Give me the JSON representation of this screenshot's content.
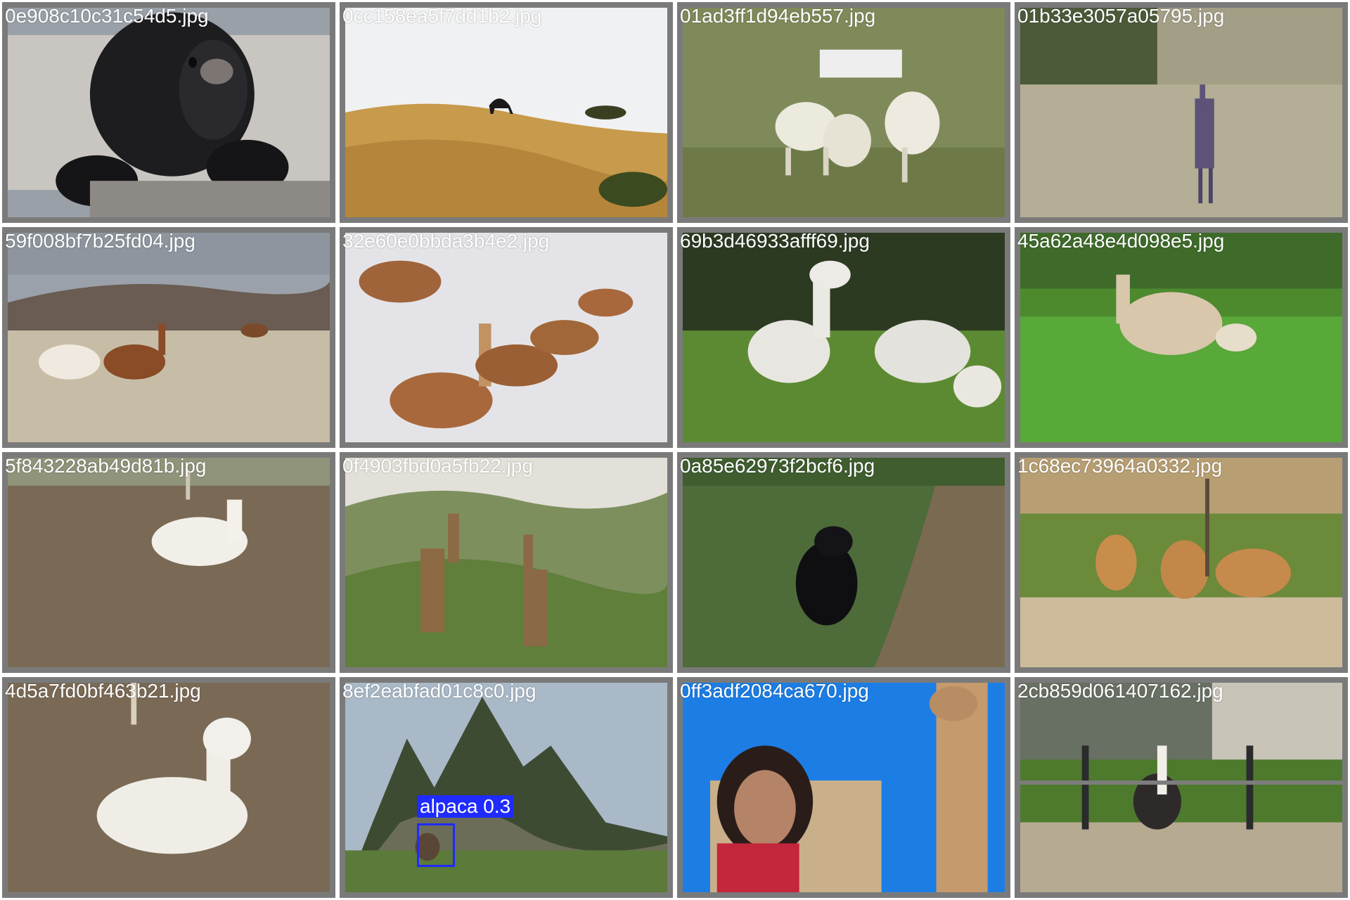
{
  "grid": {
    "cells": [
      {
        "filename": "0e908c10c31c54d5.jpg",
        "scene": "bear-closeup"
      },
      {
        "filename": "0cc158ea5f7dd1b2.jpg",
        "scene": "camel-dune"
      },
      {
        "filename": "01ad3ff1d94eb557.jpg",
        "scene": "lambs-sign"
      },
      {
        "filename": "01b33e3057a05795.jpg",
        "scene": "giraffe-grass"
      },
      {
        "filename": "59f008bf7b25fd04.jpg",
        "scene": "llamas-steppe"
      },
      {
        "filename": "32e60e0bbda3b4e2.jpg",
        "scene": "guanacos-snow"
      },
      {
        "filename": "69b3d46933afff69.jpg",
        "scene": "alpacas-white"
      },
      {
        "filename": "45a62a48e4d098e5.jpg",
        "scene": "alpaca-grazing"
      },
      {
        "filename": "5f843228ab49d81b.jpg",
        "scene": "alpaca-resting"
      },
      {
        "filename": "0f4903fbd0a5fb22.jpg",
        "scene": "giraffes-hills"
      },
      {
        "filename": "0a85e62973f2bcf6.jpg",
        "scene": "bear-forest"
      },
      {
        "filename": "1c68ec73964a0332.jpg",
        "scene": "camels-desert"
      },
      {
        "filename": "4d5a7fd0bf463b21.jpg",
        "scene": "alpaca-lying"
      },
      {
        "filename": "8ef2eabfad01c8c0.jpg",
        "scene": "machu-picchu",
        "detection": {
          "label": "alpaca 0.3"
        }
      },
      {
        "filename": "0ff3adf2084ca670.jpg",
        "scene": "giraffe-woman"
      },
      {
        "filename": "2cb859d061407162.jpg",
        "scene": "llama-farm"
      }
    ]
  },
  "colors": {
    "cell_background": "#7a7a7a",
    "cell_border": "#ffffff",
    "filename_text": "#ffffff",
    "detection_box": "#1f2bff"
  }
}
